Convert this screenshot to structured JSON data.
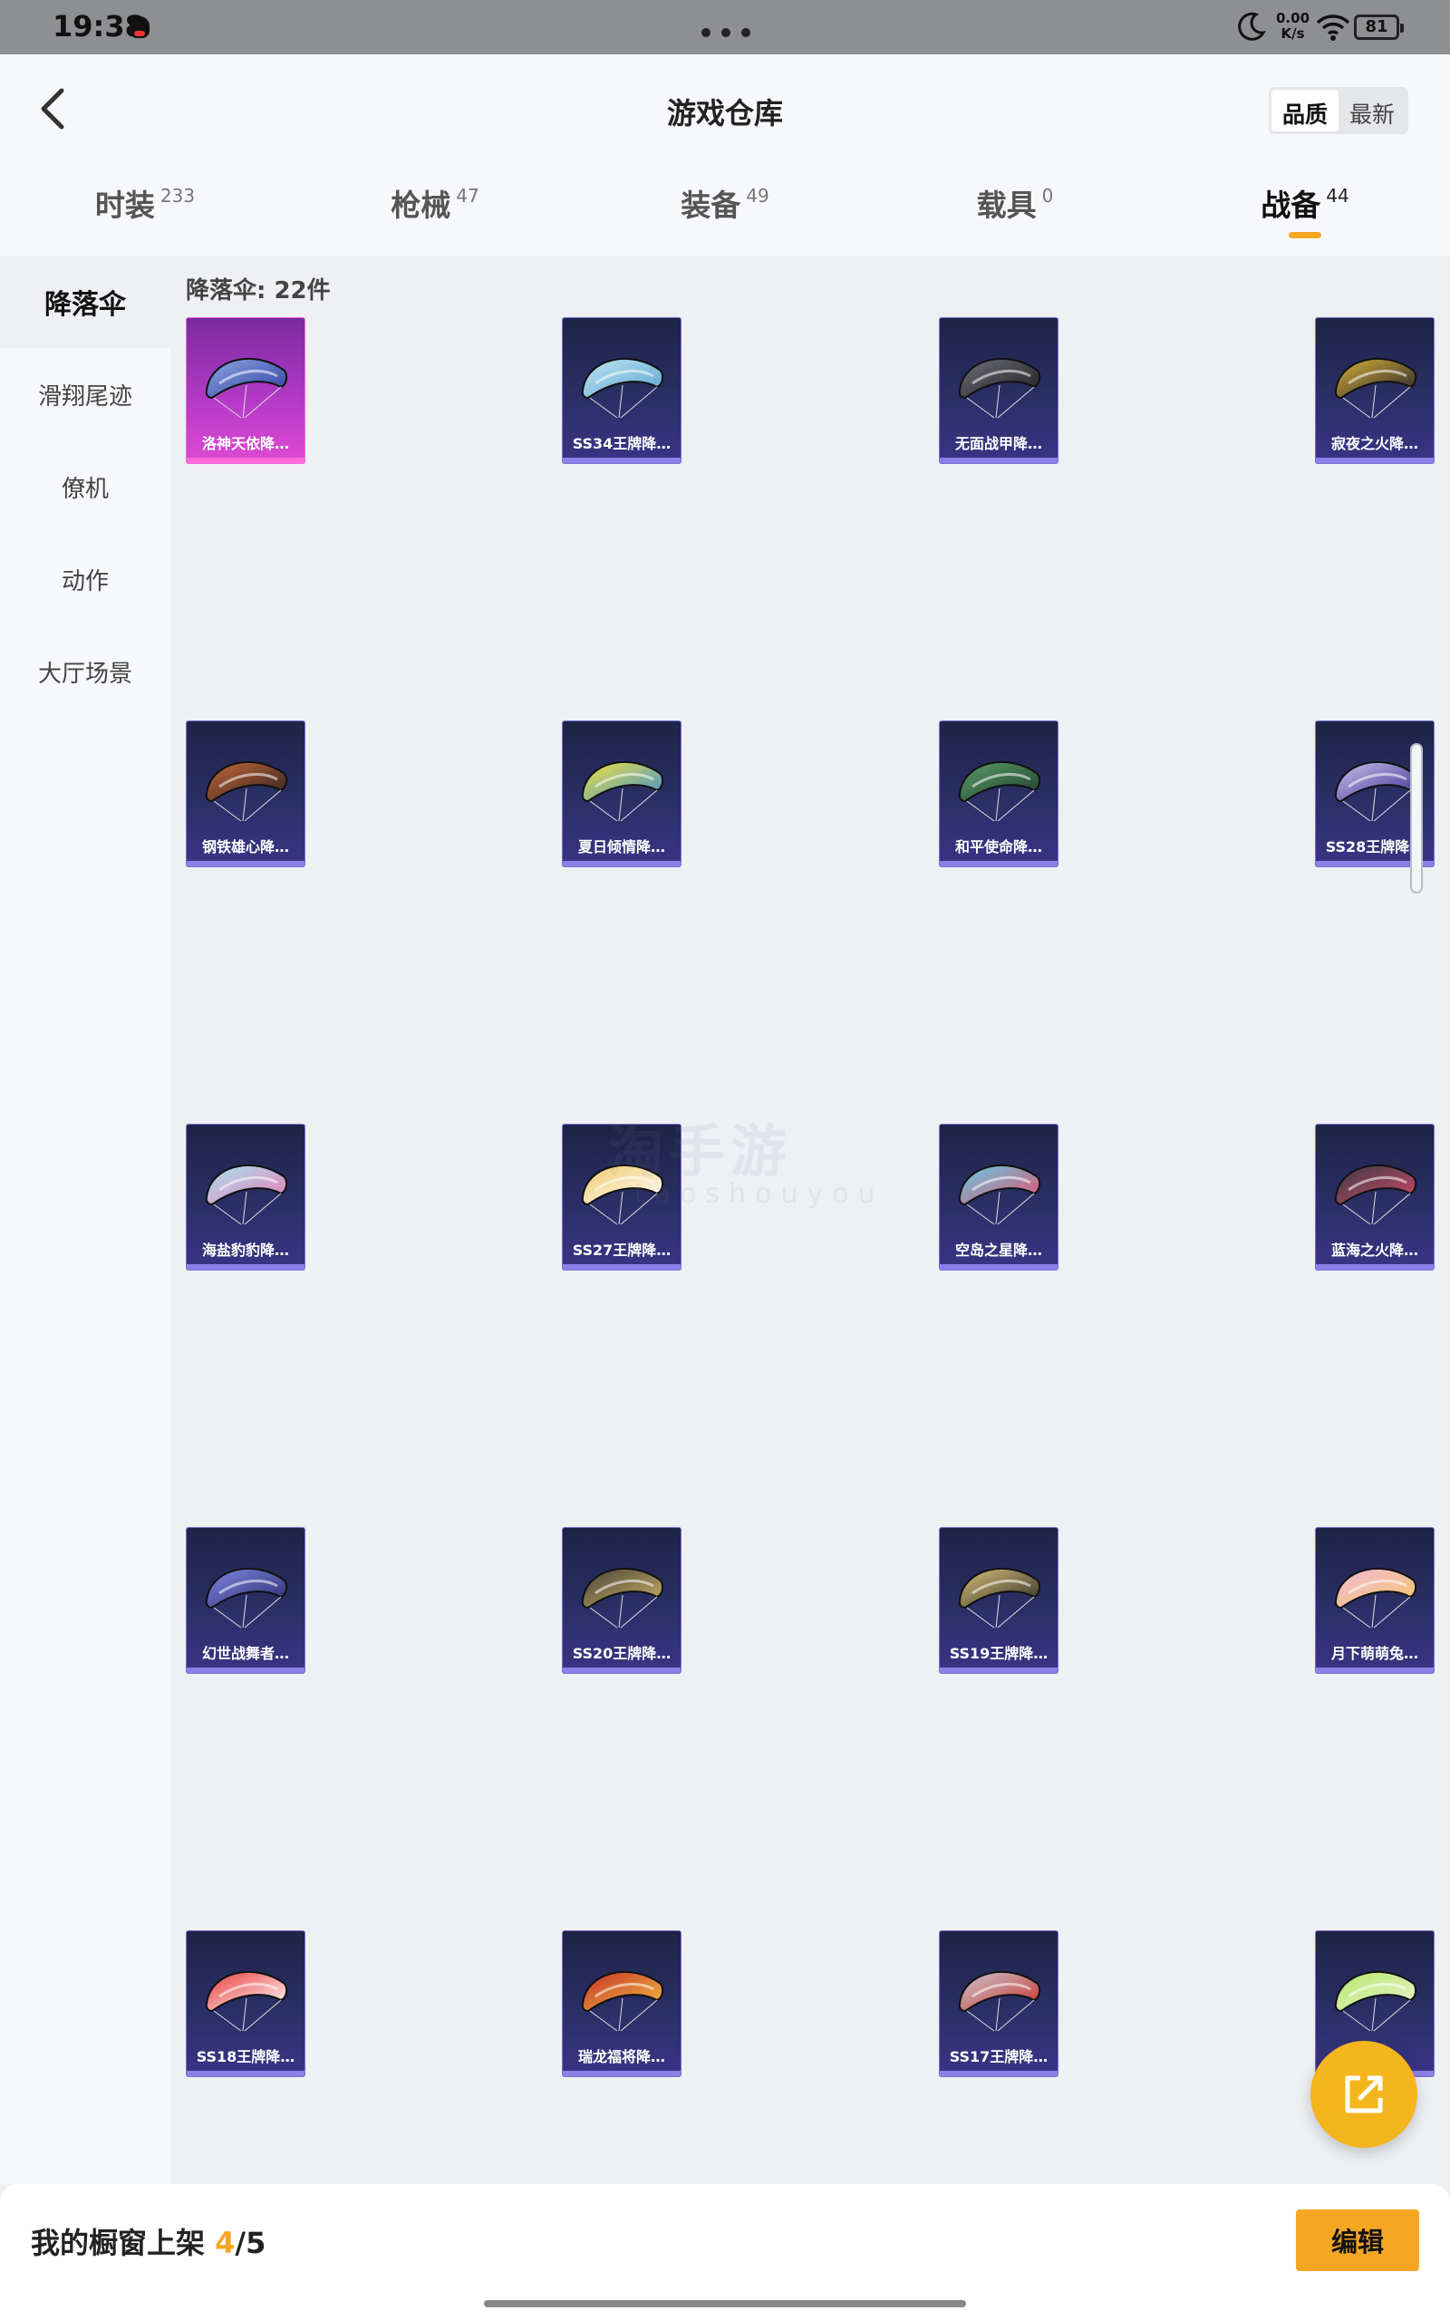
{
  "status_bar": {
    "time": "19:38",
    "speed_value": "0.00",
    "speed_unit": "K/s",
    "battery": "81"
  },
  "header": {
    "title": "游戏仓库",
    "sort_options": [
      "品质",
      "最新"
    ]
  },
  "tabs": [
    {
      "label": "时装",
      "count": "233"
    },
    {
      "label": "枪械",
      "count": "47"
    },
    {
      "label": "装备",
      "count": "49"
    },
    {
      "label": "载具",
      "count": "0"
    },
    {
      "label": "战备",
      "count": "44",
      "active": true
    }
  ],
  "sidebar": {
    "items": [
      "降落伞",
      "滑翔尾迹",
      "僚机",
      "动作",
      "大厅场景"
    ]
  },
  "content": {
    "section_title": "降落伞: 22件",
    "items": [
      {
        "name": "洛神天依降…",
        "colors": [
          "#8fa6e8",
          "#2c3f9a"
        ]
      },
      {
        "name": "SS34王牌降…",
        "colors": [
          "#bfe3f2",
          "#5aa7cf"
        ]
      },
      {
        "name": "无面战甲降…",
        "colors": [
          "#6f6f78",
          "#1d1d22"
        ]
      },
      {
        "name": "寂夜之火降…",
        "colors": [
          "#d9b23c",
          "#222028"
        ]
      },
      {
        "name": "钢铁雄心降…",
        "colors": [
          "#c8673a",
          "#2a2220"
        ]
      },
      {
        "name": "夏日倾情降…",
        "colors": [
          "#f4e43a",
          "#3a8fd6"
        ]
      },
      {
        "name": "和平使命降…",
        "colors": [
          "#5b9e6a",
          "#1f3c2a"
        ]
      },
      {
        "name": "SS28王牌降…",
        "colors": [
          "#c9c2ef",
          "#3b2f8c"
        ]
      },
      {
        "name": "海盐豹豹降…",
        "colors": [
          "#a8e4ef",
          "#e87ab8"
        ]
      },
      {
        "name": "SS27王牌降…",
        "colors": [
          "#f1c86a",
          "#ffffff"
        ]
      },
      {
        "name": "空岛之星降…",
        "colors": [
          "#5fd0e8",
          "#e84a6a"
        ]
      },
      {
        "name": "蓝海之火降…",
        "colors": [
          "#3a3a44",
          "#d04a6a"
        ]
      },
      {
        "name": "幻世战舞者…",
        "colors": [
          "#7f86e0",
          "#2a2f70"
        ]
      },
      {
        "name": "SS20王牌降…",
        "colors": [
          "#4a4536",
          "#c9b06a"
        ]
      },
      {
        "name": "SS19王牌降…",
        "colors": [
          "#d9c27a",
          "#2e2b26"
        ]
      },
      {
        "name": "月下萌萌兔…",
        "colors": [
          "#f2b8d8",
          "#f3c86a"
        ]
      },
      {
        "name": "SS18王牌降…",
        "colors": [
          "#e83a3a",
          "#ffffff"
        ]
      },
      {
        "name": "瑞龙福将降…",
        "colors": [
          "#c8302a",
          "#f0c040"
        ]
      },
      {
        "name": "SS17王牌降…",
        "colors": [
          "#c9c9d2",
          "#c8302a"
        ]
      },
      {
        "name": "…",
        "colors": [
          "#b6e86a",
          "#e8f2d0"
        ]
      }
    ]
  },
  "watermark": {
    "text": "淘手游",
    "sub": "taoshouyou"
  },
  "bottom_bar": {
    "label": "我的橱窗上架",
    "current": "4",
    "separator": "/",
    "total": "5",
    "edit_label": "编辑"
  },
  "colors": {
    "accent": "#f5a623",
    "card_bg": "#2a2f66",
    "selected_card": "#b63bc9"
  }
}
